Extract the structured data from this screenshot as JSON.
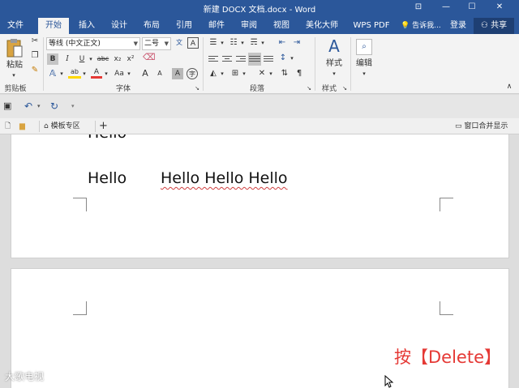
{
  "window": {
    "title": "新建 DOCX 文档.docx - Word",
    "controls": [
      "⊡",
      "—",
      "☐",
      "✕"
    ]
  },
  "tabs": [
    {
      "label": "文件"
    },
    {
      "label": "开始"
    },
    {
      "label": "插入"
    },
    {
      "label": "设计"
    },
    {
      "label": "布局"
    },
    {
      "label": "引用"
    },
    {
      "label": "邮件"
    },
    {
      "label": "审阅"
    },
    {
      "label": "视图"
    },
    {
      "label": "美化大师"
    },
    {
      "label": "WPS PDF"
    }
  ],
  "tell_me": "告诉我...",
  "login": "登录",
  "share": "共享",
  "ribbon": {
    "paste_label": "粘贴",
    "clipboard_group": "剪贴板",
    "font_name": "等线 (中文正文)",
    "font_size": "二号",
    "font_group": "字体",
    "paragraph_group": "段落",
    "styles_label": "样式",
    "styles_group": "样式",
    "edit_label": "编辑",
    "bold": "B",
    "italic": "I",
    "underline": "U",
    "strike": "abc",
    "subscript": "x₂",
    "superscript": "x²",
    "grow_font": "A",
    "shrink_font": "A",
    "change_case": "Aa",
    "font_color": "A",
    "highlight": "ab",
    "char_shade": "A",
    "phonetic": "文",
    "border_char": "A",
    "circle_char": "字",
    "accent_color": "#2b579a",
    "font_color_bar": "#e53935",
    "highlight_bar": "#ffd800"
  },
  "qat": {
    "save": "💾",
    "undo": "↶",
    "redo": "↻"
  },
  "doctabs": {
    "template_zone": "模板专区",
    "add": "+",
    "merge_window": "窗口合并显示"
  },
  "document": {
    "line_partial": "Hello",
    "line_hello": "Hello",
    "line_hellos": "Hello Hello Hello"
  },
  "overlay_text": "按【Delete】",
  "watermark": "大歌电视"
}
